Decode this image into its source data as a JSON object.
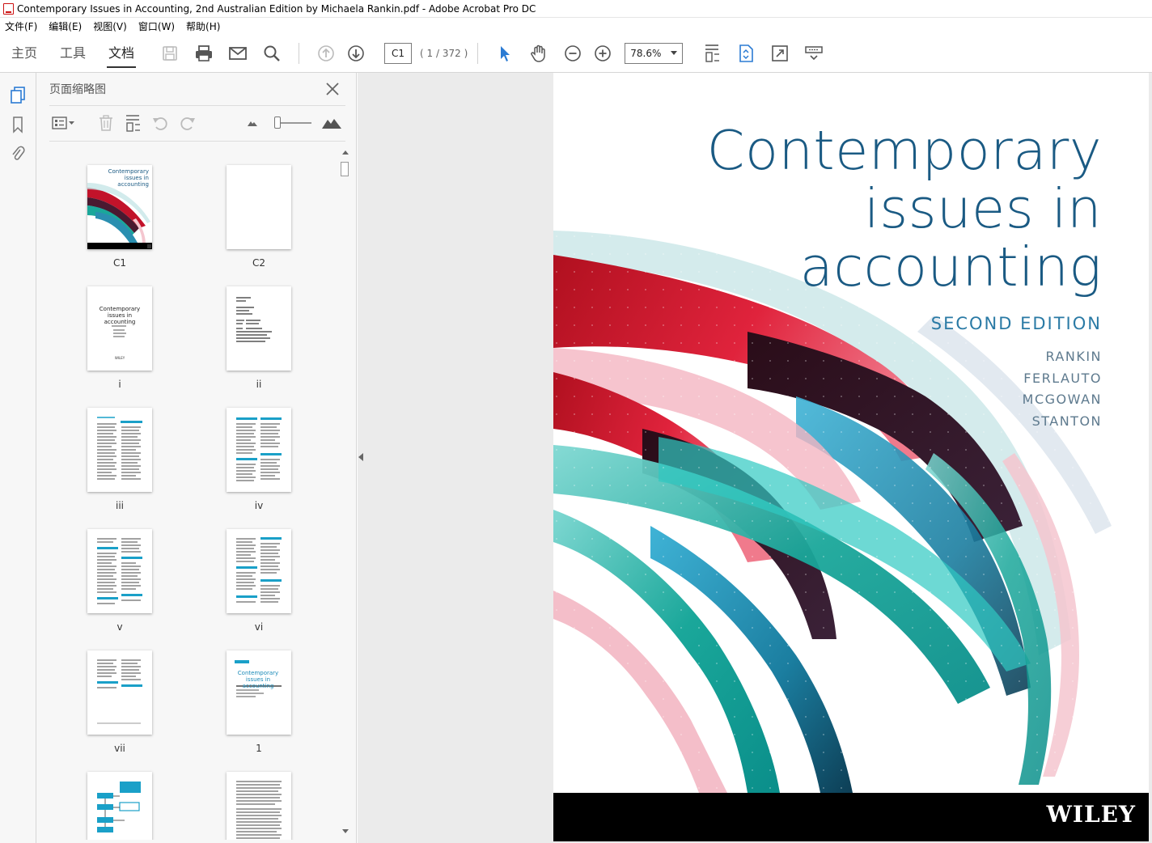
{
  "window": {
    "title": "Contemporary Issues in Accounting, 2nd Australian Edition by Michaela Rankin.pdf - Adobe Acrobat Pro DC"
  },
  "menu": {
    "items": [
      "文件(F)",
      "编辑(E)",
      "视图(V)",
      "窗口(W)",
      "帮助(H)"
    ]
  },
  "toolbar": {
    "tabs": [
      "主页",
      "工具",
      "文档"
    ],
    "active_tab": "文档",
    "page_input": "C1",
    "page_count": "( 1 / 372 )",
    "zoom": "78.6%"
  },
  "panel": {
    "title": "页面缩略图",
    "thumbnails": [
      "C1",
      "C2",
      "i",
      "ii",
      "iii",
      "iv",
      "v",
      "vi",
      "vii",
      "1",
      "",
      ""
    ]
  },
  "thumb_text": {
    "c1_title": "Contemporary issues in accounting",
    "i_title": "Contemporary issues in accounting",
    "i_publisher": "WILEY",
    "p1_title": "Contemporary issues in accounting"
  },
  "cover": {
    "title_lines": [
      "Contemporary",
      "issues in",
      "accounting"
    ],
    "edition": "SECOND EDITION",
    "authors": [
      "RANKIN",
      "FERLAUTO",
      "MCGOWAN",
      "STANTON"
    ],
    "publisher": "WILEY"
  },
  "colors": {
    "title_blue": "#1a5a83",
    "accent_teal": "#1aa79a",
    "accent_red": "#c2132a",
    "icon_blue": "#2b7bd3"
  }
}
